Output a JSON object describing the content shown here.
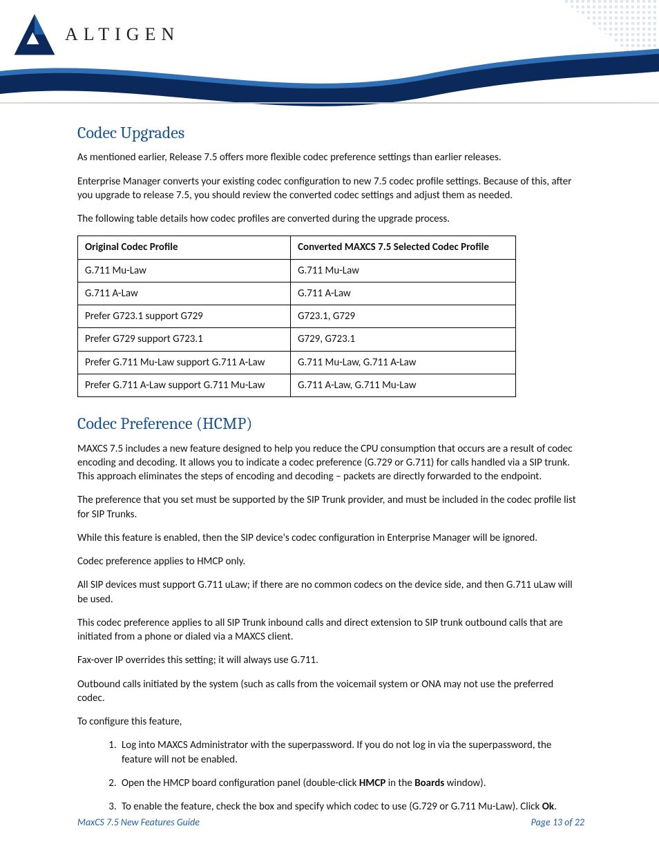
{
  "brand": {
    "name": "ALTIGEN"
  },
  "section1": {
    "heading": "Codec Upgrades",
    "p1": "As mentioned earlier, Release 7.5 offers more flexible codec preference settings than earlier releases.",
    "p2": "Enterprise Manager converts your existing codec configuration to new 7.5 codec profile settings. Because of this, after you upgrade to release 7.5, you should review the converted codec settings and adjust them as needed.",
    "p3": "The following table details how codec profiles are converted during the upgrade process.",
    "table": {
      "head": [
        "Original Codec Profile",
        "Converted MAXCS 7.5  Selected Codec Profile"
      ],
      "rows": [
        [
          "G.711 Mu-Law",
          "G.711 Mu-Law"
        ],
        [
          "G.711 A-Law",
          "G.711 A-Law"
        ],
        [
          "Prefer G723.1 support  G729",
          "G723.1, G729"
        ],
        [
          "Prefer G729 support  G723.1",
          "G729, G723.1"
        ],
        [
          "Prefer G.711 Mu-Law support  G.711 A-Law",
          "G.711 Mu-Law, G.711 A-Law"
        ],
        [
          "Prefer G.711 A-Law support  G.711 Mu-Law",
          "G.711 A-Law, G.711 Mu-Law"
        ]
      ]
    }
  },
  "section2": {
    "heading": "Codec Preference (HCMP)",
    "p1": "MAXCS 7.5 includes a new feature designed to help you reduce the CPU consumption that occurs are a result of codec encoding and decoding. It allows you to indicate a codec preference (G.729 or G.711) for calls handled via a SIP trunk. This approach eliminates the steps of encoding and decoding – packets are directly forwarded to the endpoint.",
    "p2": "The preference that you set must be supported by the SIP Trunk provider, and must be included in the codec profile list for SIP Trunks.",
    "p3": "While this feature is enabled, then the SIP device's codec configuration in Enterprise Manager will be ignored.",
    "p4": "Codec preference applies to HMCP only.",
    "p5": "All SIP devices must support G.711 uLaw; if there are no common codecs on the device side, and then G.711 uLaw will be used.",
    "p6": "This codec preference applies to all SIP Trunk inbound calls and direct extension to SIP trunk outbound calls that are initiated from a phone or dialed via a MAXCS client.",
    "p7": "Fax-over IP overrides this setting; it will always use G.711.",
    "p8": "Outbound calls initiated by the system (such as calls from the voicemail system or ONA may not use the preferred codec.",
    "lead": "To configure this feature,",
    "steps": {
      "s1": "Log into MAXCS Administrator with the superpassword. If you do not log in via the superpassword, the feature will not be enabled.",
      "s2_a": "Open the HMCP board configuration panel (double-click ",
      "s2_b1": "HMCP",
      "s2_c": " in the ",
      "s2_b2": "Boards",
      "s2_d": " window).",
      "s3_a": "To enable the feature, check the box and specify which codec to use (G.729 or G.711 Mu-Law). Click ",
      "s3_b": "Ok",
      "s3_c": "."
    }
  },
  "footer": {
    "left": "MaxCS 7.5 New Features Guide",
    "right": "Page 13 of 22"
  }
}
